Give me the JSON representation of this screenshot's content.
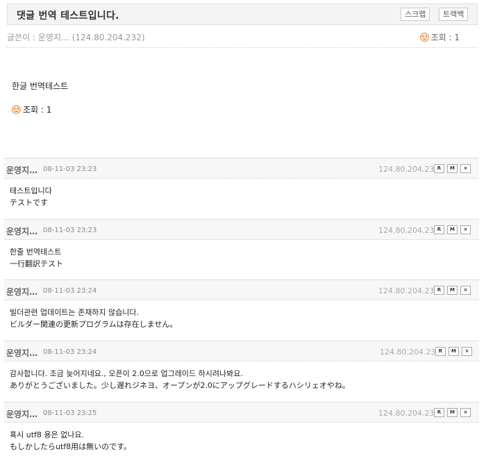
{
  "post": {
    "title": "댓글 번역 테스트입니다.",
    "scrap_label": "스크랩",
    "trackback_label": "트랙백",
    "author_line": "글쓴이 : 운영지… (124.80.204.232)",
    "views_label": "조회 : 1",
    "body": "한글 번역테스트",
    "body_views": "조회 : 1"
  },
  "comment_buttons": [
    "R",
    "M",
    "×"
  ],
  "comments": [
    {
      "author": "운영지…",
      "date": "08-11-03 23:23",
      "ip": "124.80.204.232",
      "line1": "테스트입니다",
      "line2": "テストです"
    },
    {
      "author": "운영지…",
      "date": "08-11-03 23:23",
      "ip": "124.80.204.232",
      "line1": "한줄 번역테스트",
      "line2": "一行翻訳テスト"
    },
    {
      "author": "운영지…",
      "date": "08-11-03 23:24",
      "ip": "124.80.204.232",
      "line1": "빌더관련 업데이트는 존재하지 않습니다.",
      "line2": "ビルダー関連の更新プログラムは存在しません。"
    },
    {
      "author": "운영지…",
      "date": "08-11-03 23:24",
      "ip": "124.80.204.232",
      "line1": "감사합니다. 조금 늦어지네요., 오픈이 2.0으로 업그레이드 하시려나봐요.",
      "line2": "ありがとうございました。少し遅れジネヨ、オープンが2.0にアップグレードするハシリェオやね。"
    },
    {
      "author": "운영지…",
      "date": "08-11-03 23:25",
      "ip": "124.80.204.232",
      "line1": "혹시 utf8 용은 없나요.",
      "line2": "もしかしたらutf8用は無いのです。"
    }
  ]
}
